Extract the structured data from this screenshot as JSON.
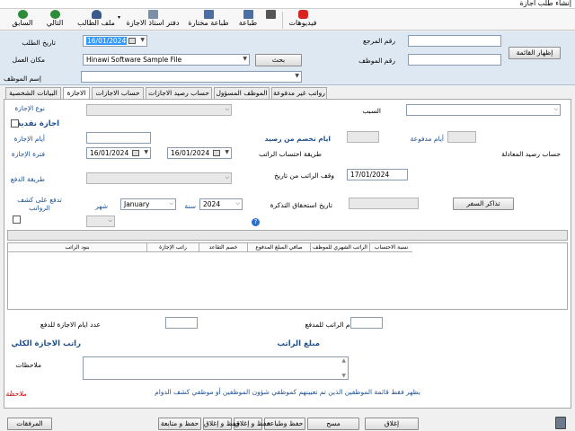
{
  "window": {
    "title": "إنشاء طلب اجازة"
  },
  "toolbar": [
    {
      "key": "videos",
      "label": "فيديوهات",
      "icon": "youtube-icon",
      "color": "#d92323"
    },
    {
      "key": "print",
      "label": "",
      "icon": "printer-icon",
      "color": "#555555"
    },
    {
      "key": "print2",
      "label": "طباعة",
      "icon": "printer-icon",
      "color": "#4a6fa5"
    },
    {
      "key": "print_selected",
      "label": "طباعة مختارة",
      "icon": "printer-icon",
      "color": "#4a6fa5"
    },
    {
      "key": "ledger",
      "label": "دفتر استاذ الاجازة",
      "icon": "ledger-icon",
      "color": "#7a8fa8"
    },
    {
      "key": "applicant_file",
      "label": "ملف الطالب",
      "icon": "user-icon",
      "color": "#3b5a8a"
    },
    {
      "key": "next",
      "label": "التالي",
      "icon": "arrow-right-icon",
      "color": "#2e8b3a"
    },
    {
      "key": "prev",
      "label": "السابق",
      "icon": "arrow-left-icon",
      "color": "#2e8b3a"
    }
  ],
  "header": {
    "ref_label": "رقم المرجع",
    "ref_value": "",
    "emp_no_label": "رقم الموظف",
    "emp_no_value": "",
    "emp_name_label": "إسم الموظف",
    "emp_name_value": "",
    "date_label": "تاريخ الطلب",
    "date_value": "16/01/2024",
    "workplace_label": "مكان العمل",
    "workplace_value": "Hinawi Software Sample File",
    "search_label": "بحث",
    "show_list_label": "إظهار القائمة"
  },
  "tabs": [
    {
      "label": "رواتب غير مدفوعة"
    },
    {
      "label": "الموظف المسؤول"
    },
    {
      "label": "حساب رصيد الاجازات"
    },
    {
      "label": "حساب الاجازات"
    },
    {
      "label": "الاجازة"
    },
    {
      "label": "البيانات الشخصية"
    }
  ],
  "form": {
    "reason_label": "السبب",
    "reason_value": "",
    "leave_type_label": "نوع الإجازة",
    "cash_leave_label": "اجازة نقدية",
    "leave_days_label": "أيام الإجازة",
    "leave_days_value": "",
    "no_balance_days_label": "ايام تخصم من رصيد",
    "no_balance_days_value": "",
    "paid_days_label": "أيام مدفوعة",
    "paid_days_value": "",
    "period_label": "فترة الإجازة",
    "period_from": "16/01/2024",
    "period_to": "16/01/2024",
    "salary_calc_label": "طريقة احتساب الراتب",
    "equiv_balance_label": "حساب رصيد المعادلة",
    "pay_method_label": "طريقة الدفع",
    "salary_stop_label": "وقف الراتب من تاريخ",
    "salary_stop_value": "17/01/2024",
    "pay_on_payroll_label": "تدفع على كشف الرواتب",
    "month_label": "شهر",
    "month_value": "January",
    "year_label": "سنة",
    "year_value": "2024",
    "ticket_due_label": "تاريخ استحقاق التذكرة",
    "ticket_due_value": "",
    "travel_tickets_label": "تذاكر السفر",
    "help_glyph": "?"
  },
  "grid": {
    "columns": [
      {
        "label": "نسبة الاحتساب"
      },
      {
        "label": "الراتب الشهري للموظف"
      },
      {
        "label": "صافي المبلغ المدفوع"
      },
      {
        "label": "خصم التقاعد"
      },
      {
        "label": "راتب الإجازة"
      },
      {
        "label": "بنود الراتب"
      }
    ]
  },
  "summary": {
    "salary_days_label": "ايام الراتب للمدفع",
    "salary_days_value": "",
    "leave_days_pay_label": "عدد ايام الاجازة للدفع",
    "leave_days_pay_value": "",
    "salary_amount_label": "مبلغ الراتب",
    "total_leave_salary_label": "راتب الاجازة الكلي",
    "notes_label": "ملاحظات",
    "notes_value": ""
  },
  "notice": {
    "label": "ملاحظة",
    "text": "يظهر فقط قائمة الموظفين الذين تم تعيينهم كموظفي شؤون الموظفين أو موظفي كشف الدوام"
  },
  "footer": {
    "close": "إغلاق",
    "clear": "مسح",
    "save_print": "حفظ وطباعة",
    "save_close": "حفظ و إغلاق",
    "save_close2": "حفظ و إغلاق",
    "save_continue": "حفظ و متابعة",
    "attachments": "المرفقات"
  }
}
